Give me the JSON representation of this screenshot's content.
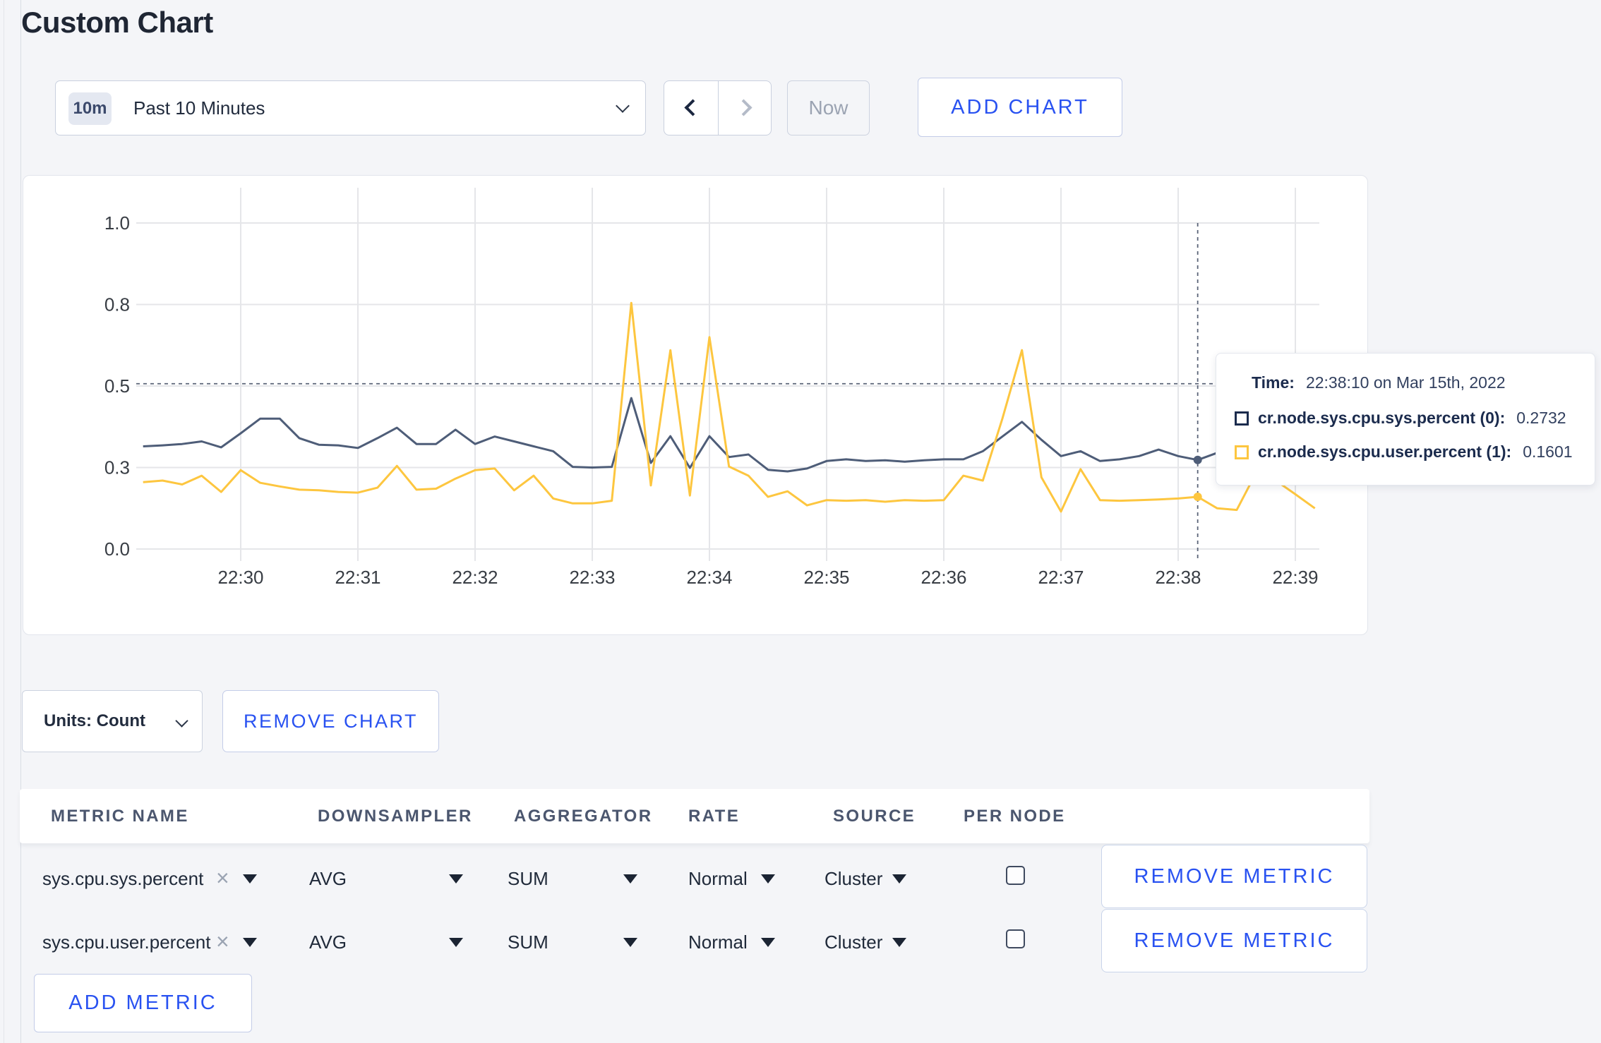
{
  "title": "Custom Chart",
  "toolbar": {
    "range_badge": "10m",
    "range_label": "Past 10 Minutes",
    "now_label": "Now",
    "add_chart_label": "ADD CHART"
  },
  "chart_data": {
    "type": "line",
    "title": "",
    "xlabel": "",
    "ylabel": "",
    "ylim": [
      0,
      1.14
    ],
    "grid": true,
    "x_ticks": [
      {
        "min": 0,
        "label": "22:30"
      },
      {
        "min": 1,
        "label": "22:31"
      },
      {
        "min": 2,
        "label": "22:32"
      },
      {
        "min": 3,
        "label": "22:33"
      },
      {
        "min": 4,
        "label": "22:34"
      },
      {
        "min": 5,
        "label": "22:35"
      },
      {
        "min": 6,
        "label": "22:36"
      },
      {
        "min": 7,
        "label": "22:37"
      },
      {
        "min": 8,
        "label": "22:38"
      },
      {
        "min": 9,
        "label": "22:39"
      }
    ],
    "y_ticks": [
      {
        "v": 0,
        "label": "0.0"
      },
      {
        "v": 0.25,
        "label": "0.3"
      },
      {
        "v": 0.5,
        "label": "0.5"
      },
      {
        "v": 0.75,
        "label": "0.8"
      },
      {
        "v": 1,
        "label": "1.0"
      }
    ],
    "start_min": -0.8333,
    "interval_sec": 10,
    "guide_value": 0.507,
    "crosshair_min": 8.1667,
    "crosshair_index": 54,
    "series": [
      {
        "name": "cr.node.sys.cpu.sys.percent (0)",
        "color": "#4e5d78",
        "values": [
          0.315,
          0.318,
          0.322,
          0.33,
          0.312,
          0.355,
          0.4,
          0.4,
          0.34,
          0.32,
          0.318,
          0.31,
          0.34,
          0.372,
          0.322,
          0.322,
          0.366,
          0.322,
          0.345,
          0.33,
          0.315,
          0.3,
          0.252,
          0.25,
          0.252,
          0.463,
          0.264,
          0.346,
          0.249,
          0.346,
          0.282,
          0.29,
          0.243,
          0.238,
          0.247,
          0.27,
          0.275,
          0.27,
          0.272,
          0.268,
          0.272,
          0.275,
          0.275,
          0.3,
          0.345,
          0.39,
          0.335,
          0.285,
          0.3,
          0.27,
          0.275,
          0.285,
          0.305,
          0.285,
          0.2732,
          0.295,
          0.3,
          0.295,
          0.29,
          0.295,
          0.295
        ]
      },
      {
        "name": "cr.node.sys.cpu.user.percent (1)",
        "color": "#fdc63f",
        "values": [
          0.205,
          0.21,
          0.198,
          0.225,
          0.175,
          0.242,
          0.203,
          0.192,
          0.182,
          0.18,
          0.175,
          0.173,
          0.188,
          0.255,
          0.182,
          0.185,
          0.216,
          0.242,
          0.247,
          0.18,
          0.225,
          0.155,
          0.14,
          0.14,
          0.148,
          0.755,
          0.195,
          0.61,
          0.164,
          0.65,
          0.253,
          0.225,
          0.16,
          0.177,
          0.134,
          0.15,
          0.148,
          0.15,
          0.145,
          0.15,
          0.148,
          0.15,
          0.225,
          0.21,
          0.4,
          0.61,
          0.22,
          0.115,
          0.245,
          0.15,
          0.148,
          0.15,
          0.152,
          0.155,
          0.1601,
          0.125,
          0.12,
          0.235,
          0.21,
          0.168,
          0.125
        ]
      }
    ],
    "tooltip": {
      "time_label": "Time:",
      "time_value": "22:38:10 on Mar 15th, 2022",
      "rows": [
        {
          "label": "cr.node.sys.cpu.sys.percent (0):",
          "value": "0.2732",
          "color": "#1b2b4d"
        },
        {
          "label": "cr.node.sys.cpu.user.percent (1):",
          "value": "0.1601",
          "color": "#fdc63f"
        }
      ]
    }
  },
  "chart_controls": {
    "units_label": "Units: Count",
    "remove_chart_label": "REMOVE CHART"
  },
  "metrics_table": {
    "headers": [
      "METRIC NAME",
      "DOWNSAMPLER",
      "AGGREGATOR",
      "RATE",
      "SOURCE",
      "PER NODE"
    ],
    "remove_metric_label": "REMOVE METRIC",
    "add_metric_label": "ADD METRIC",
    "rows": [
      {
        "metric": "sys.cpu.sys.percent",
        "downsampler": "AVG",
        "aggregator": "SUM",
        "rate": "Normal",
        "source": "Cluster",
        "per_node": false
      },
      {
        "metric": "sys.cpu.user.percent",
        "downsampler": "AVG",
        "aggregator": "SUM",
        "rate": "Normal",
        "source": "Cluster",
        "per_node": false
      }
    ]
  }
}
